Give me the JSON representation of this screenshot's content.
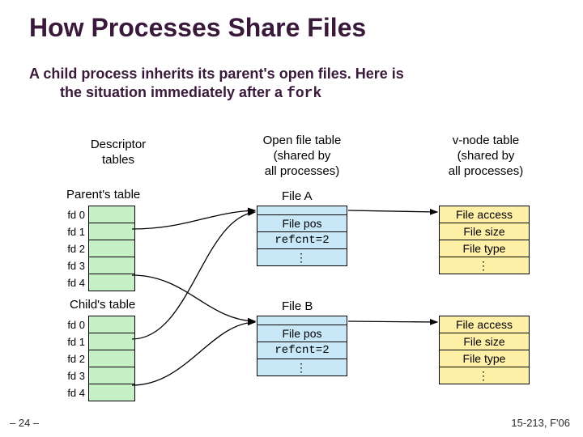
{
  "title": "How Processes Share Files",
  "lead_line1": "A child process inherits its parent's open files. Here is",
  "lead_line2": "the situation immediately after a ",
  "lead_code": "fork",
  "columns": {
    "descriptor": "Descriptor\ntables",
    "openfile": "Open file table\n(shared by\nall processes)",
    "vnode": "v-node table\n(shared by\nall processes)"
  },
  "parent_label": "Parent's table",
  "child_label": "Child's table",
  "fds": [
    "fd 0",
    "fd 1",
    "fd 2",
    "fd 3",
    "fd 4"
  ],
  "fileA_label": "File A",
  "fileB_label": "File B",
  "ofA": {
    "blank": "",
    "pos": "File pos",
    "refcnt": "refcnt=2",
    "dots": "⋮"
  },
  "ofB": {
    "blank": "",
    "pos": "File pos",
    "refcnt": "refcnt=2",
    "dots": "⋮"
  },
  "vA": {
    "access": "File access",
    "size": "File size",
    "type": "File type",
    "dots": "⋮"
  },
  "vB": {
    "access": "File access",
    "size": "File size",
    "type": "File type",
    "dots": "⋮"
  },
  "footer": {
    "left": "– 24 –",
    "right": "15-213, F'06"
  }
}
